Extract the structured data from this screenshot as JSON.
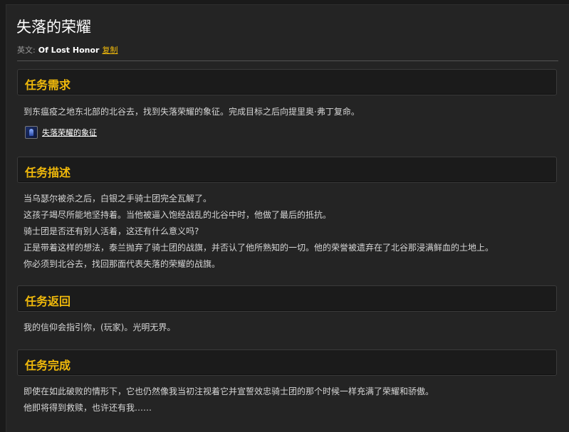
{
  "quest": {
    "title": "失落的荣耀",
    "english_label": "英文:",
    "english_name": "Of Lost Honor",
    "copy_label": "复制"
  },
  "requirements": {
    "header": "任务需求",
    "text": "到东瘟疫之地东北部的北谷去，找到失落荣耀的象征。完成目标之后向提里奥·弗丁复命。",
    "item_name": "失落荣耀的象征",
    "item_icon": "blue-banner-icon"
  },
  "description": {
    "header": "任务描述",
    "lines": [
      "当乌瑟尔被杀之后，白银之手骑士团完全瓦解了。",
      "这孩子竭尽所能地坚持着。当他被逼入饱经战乱的北谷中时，他做了最后的抵抗。",
      "骑士团是否还有别人活着，这还有什么意义吗?",
      "正是带着这样的想法，泰兰抛弃了骑士团的战旗，并否认了他所熟知的一切。他的荣誉被遗弃在了北谷那浸满鲜血的土地上。",
      "你必须到北谷去，找回那面代表失落的荣耀的战旗。"
    ]
  },
  "progress": {
    "header": "任务返回",
    "text": "我的信仰会指引你，(玩家)。光明无界。"
  },
  "completion": {
    "header": "任务完成",
    "lines": [
      "即使在如此破败的情形下，它也仍然像我当初注视着它并宣誓效忠骑士团的那个时候一样充满了荣耀和骄傲。",
      "他即将得到救赎，也许还有我……"
    ]
  },
  "colors": {
    "accent": "#f0b90b",
    "background": "#242424",
    "header_bg": "#1b1b1b"
  }
}
